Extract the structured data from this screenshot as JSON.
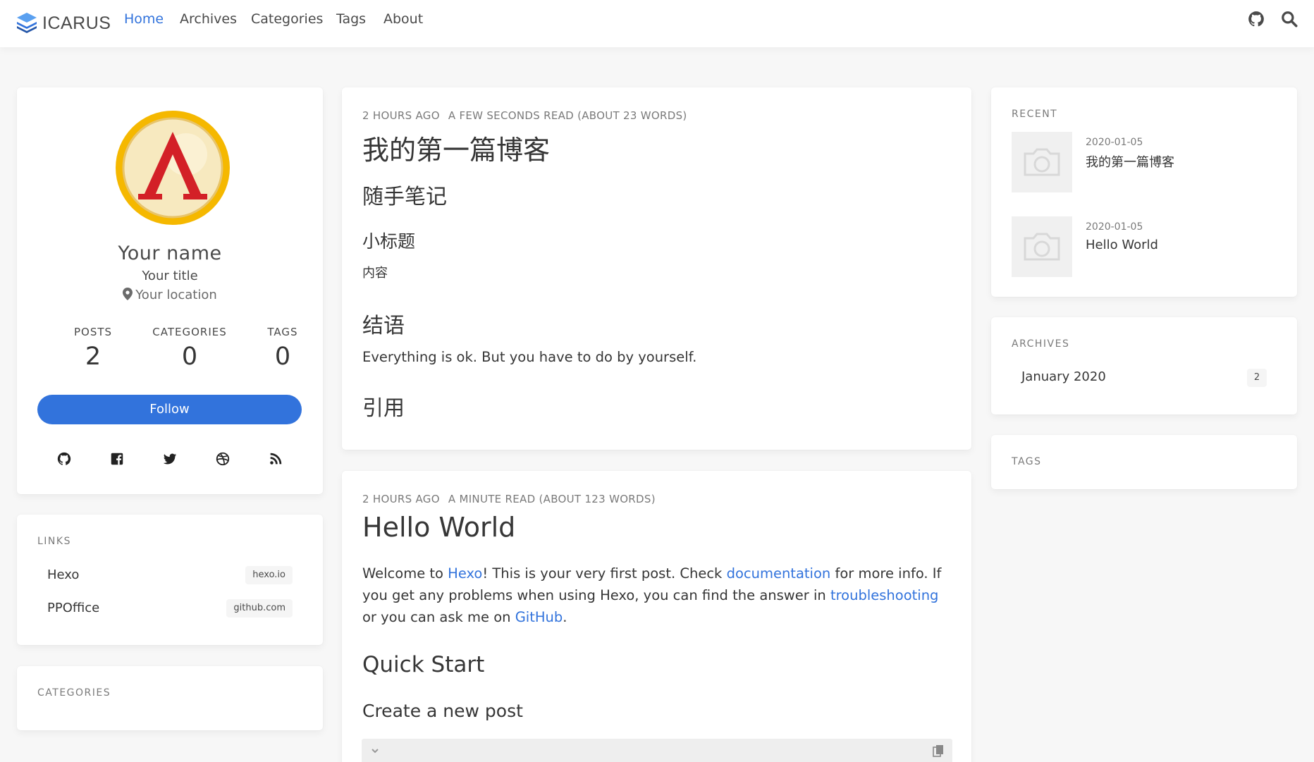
{
  "nav": {
    "brand": "ICARUS",
    "items": [
      "Home",
      "Archives",
      "Categories",
      "Tags",
      "About"
    ],
    "active": "Home"
  },
  "profile": {
    "name": "Your name",
    "title": "Your title",
    "location": "Your location",
    "stats": [
      {
        "label": "POSTS",
        "value": "2"
      },
      {
        "label": "CATEGORIES",
        "value": "0"
      },
      {
        "label": "TAGS",
        "value": "0"
      }
    ],
    "follow_label": "Follow",
    "socials": [
      "github-icon",
      "facebook-icon",
      "twitter-icon",
      "dribbble-icon",
      "rss-icon"
    ]
  },
  "links": {
    "title": "LINKS",
    "items": [
      {
        "name": "Hexo",
        "host": "hexo.io"
      },
      {
        "name": "PPOffice",
        "host": "github.com"
      }
    ]
  },
  "categories_widget": {
    "title": "CATEGORIES"
  },
  "post1": {
    "time": "2 HOURS AGO",
    "read": "A FEW SECONDS READ (ABOUT 23 WORDS)",
    "title": "我的第一篇博客",
    "h2": "随手笔记",
    "h3a": "小标题",
    "content": "内容",
    "h2b": "结语",
    "para": "Everything is ok. But you have to do by yourself.",
    "h2c": "引用"
  },
  "post2": {
    "time": "2 HOURS AGO",
    "read": "A MINUTE READ (ABOUT 123 WORDS)",
    "title": "Hello World",
    "p1_a": "Welcome to ",
    "p1_link1": "Hexo",
    "p1_b": "! This is your very first post. Check ",
    "p1_link2": "documentation",
    "p1_c": " for more info. If you get any problems when using Hexo, you can find the answer in ",
    "p1_link3": "troubleshooting",
    "p1_d": " or you can ask me on ",
    "p1_link4": "GitHub",
    "p1_e": ".",
    "h2": "Quick Start",
    "h3": "Create a new post"
  },
  "recent": {
    "title": "RECENT",
    "items": [
      {
        "date": "2020-01-05",
        "title": "我的第一篇博客"
      },
      {
        "date": "2020-01-05",
        "title": "Hello World"
      }
    ]
  },
  "archives": {
    "title": "ARCHIVES",
    "items": [
      {
        "label": "January 2020",
        "count": "2"
      }
    ]
  },
  "tags_widget": {
    "title": "TAGS"
  },
  "colors": {
    "accent": "#3273dc",
    "background": "#f7f7f7",
    "avatar_gold": "#f5b800",
    "avatar_red": "#d32027"
  }
}
